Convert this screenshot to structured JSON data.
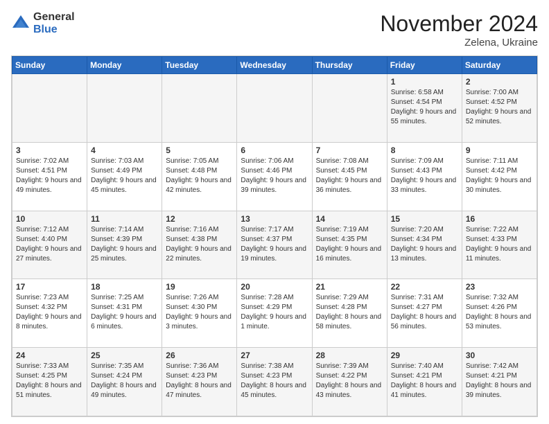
{
  "logo": {
    "general": "General",
    "blue": "Blue"
  },
  "header": {
    "month": "November 2024",
    "location": "Zelena, Ukraine"
  },
  "days_of_week": [
    "Sunday",
    "Monday",
    "Tuesday",
    "Wednesday",
    "Thursday",
    "Friday",
    "Saturday"
  ],
  "weeks": [
    [
      {
        "day": "",
        "info": ""
      },
      {
        "day": "",
        "info": ""
      },
      {
        "day": "",
        "info": ""
      },
      {
        "day": "",
        "info": ""
      },
      {
        "day": "",
        "info": ""
      },
      {
        "day": "1",
        "info": "Sunrise: 6:58 AM\nSunset: 4:54 PM\nDaylight: 9 hours and 55 minutes."
      },
      {
        "day": "2",
        "info": "Sunrise: 7:00 AM\nSunset: 4:52 PM\nDaylight: 9 hours and 52 minutes."
      }
    ],
    [
      {
        "day": "3",
        "info": "Sunrise: 7:02 AM\nSunset: 4:51 PM\nDaylight: 9 hours and 49 minutes."
      },
      {
        "day": "4",
        "info": "Sunrise: 7:03 AM\nSunset: 4:49 PM\nDaylight: 9 hours and 45 minutes."
      },
      {
        "day": "5",
        "info": "Sunrise: 7:05 AM\nSunset: 4:48 PM\nDaylight: 9 hours and 42 minutes."
      },
      {
        "day": "6",
        "info": "Sunrise: 7:06 AM\nSunset: 4:46 PM\nDaylight: 9 hours and 39 minutes."
      },
      {
        "day": "7",
        "info": "Sunrise: 7:08 AM\nSunset: 4:45 PM\nDaylight: 9 hours and 36 minutes."
      },
      {
        "day": "8",
        "info": "Sunrise: 7:09 AM\nSunset: 4:43 PM\nDaylight: 9 hours and 33 minutes."
      },
      {
        "day": "9",
        "info": "Sunrise: 7:11 AM\nSunset: 4:42 PM\nDaylight: 9 hours and 30 minutes."
      }
    ],
    [
      {
        "day": "10",
        "info": "Sunrise: 7:12 AM\nSunset: 4:40 PM\nDaylight: 9 hours and 27 minutes."
      },
      {
        "day": "11",
        "info": "Sunrise: 7:14 AM\nSunset: 4:39 PM\nDaylight: 9 hours and 25 minutes."
      },
      {
        "day": "12",
        "info": "Sunrise: 7:16 AM\nSunset: 4:38 PM\nDaylight: 9 hours and 22 minutes."
      },
      {
        "day": "13",
        "info": "Sunrise: 7:17 AM\nSunset: 4:37 PM\nDaylight: 9 hours and 19 minutes."
      },
      {
        "day": "14",
        "info": "Sunrise: 7:19 AM\nSunset: 4:35 PM\nDaylight: 9 hours and 16 minutes."
      },
      {
        "day": "15",
        "info": "Sunrise: 7:20 AM\nSunset: 4:34 PM\nDaylight: 9 hours and 13 minutes."
      },
      {
        "day": "16",
        "info": "Sunrise: 7:22 AM\nSunset: 4:33 PM\nDaylight: 9 hours and 11 minutes."
      }
    ],
    [
      {
        "day": "17",
        "info": "Sunrise: 7:23 AM\nSunset: 4:32 PM\nDaylight: 9 hours and 8 minutes."
      },
      {
        "day": "18",
        "info": "Sunrise: 7:25 AM\nSunset: 4:31 PM\nDaylight: 9 hours and 6 minutes."
      },
      {
        "day": "19",
        "info": "Sunrise: 7:26 AM\nSunset: 4:30 PM\nDaylight: 9 hours and 3 minutes."
      },
      {
        "day": "20",
        "info": "Sunrise: 7:28 AM\nSunset: 4:29 PM\nDaylight: 9 hours and 1 minute."
      },
      {
        "day": "21",
        "info": "Sunrise: 7:29 AM\nSunset: 4:28 PM\nDaylight: 8 hours and 58 minutes."
      },
      {
        "day": "22",
        "info": "Sunrise: 7:31 AM\nSunset: 4:27 PM\nDaylight: 8 hours and 56 minutes."
      },
      {
        "day": "23",
        "info": "Sunrise: 7:32 AM\nSunset: 4:26 PM\nDaylight: 8 hours and 53 minutes."
      }
    ],
    [
      {
        "day": "24",
        "info": "Sunrise: 7:33 AM\nSunset: 4:25 PM\nDaylight: 8 hours and 51 minutes."
      },
      {
        "day": "25",
        "info": "Sunrise: 7:35 AM\nSunset: 4:24 PM\nDaylight: 8 hours and 49 minutes."
      },
      {
        "day": "26",
        "info": "Sunrise: 7:36 AM\nSunset: 4:23 PM\nDaylight: 8 hours and 47 minutes."
      },
      {
        "day": "27",
        "info": "Sunrise: 7:38 AM\nSunset: 4:23 PM\nDaylight: 8 hours and 45 minutes."
      },
      {
        "day": "28",
        "info": "Sunrise: 7:39 AM\nSunset: 4:22 PM\nDaylight: 8 hours and 43 minutes."
      },
      {
        "day": "29",
        "info": "Sunrise: 7:40 AM\nSunset: 4:21 PM\nDaylight: 8 hours and 41 minutes."
      },
      {
        "day": "30",
        "info": "Sunrise: 7:42 AM\nSunset: 4:21 PM\nDaylight: 8 hours and 39 minutes."
      }
    ]
  ]
}
